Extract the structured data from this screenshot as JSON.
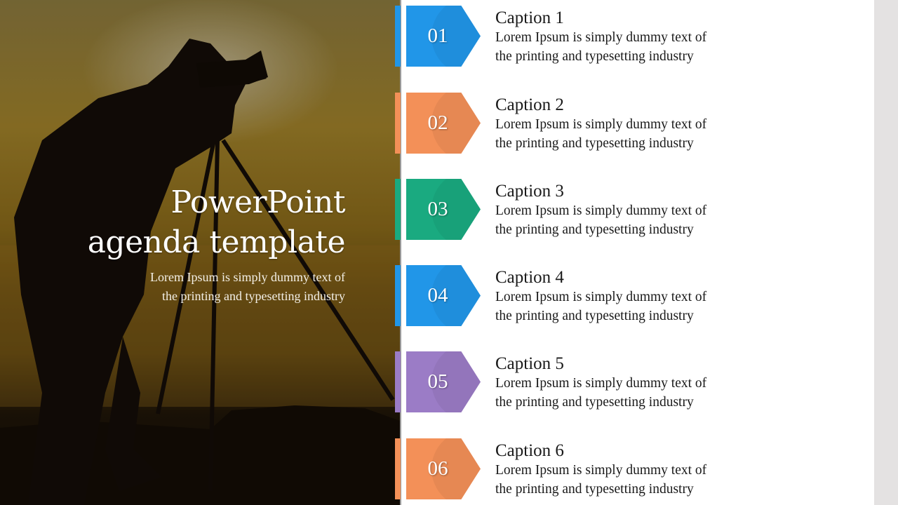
{
  "slide": {
    "title_lines": [
      "PowerPoint",
      "agenda template"
    ],
    "description_lines": [
      "Lorem Ipsum is simply dummy text of",
      "the printing and typesetting industry"
    ],
    "image": "photographer-silhouette-sunset"
  },
  "agenda": [
    {
      "number": "01",
      "caption": "Caption 1",
      "lines": [
        "Lorem Ipsum is simply dummy text of",
        "the printing and typesetting industry"
      ],
      "color": "#2196e8"
    },
    {
      "number": "02",
      "caption": "Caption 2",
      "lines": [
        "Lorem Ipsum is simply dummy text of",
        "the printing and typesetting industry"
      ],
      "color": "#f39058"
    },
    {
      "number": "03",
      "caption": "Caption 3",
      "lines": [
        "Lorem Ipsum is simply dummy text of",
        "the printing and typesetting industry"
      ],
      "color": "#1aaa80"
    },
    {
      "number": "04",
      "caption": "Caption 4",
      "lines": [
        "Lorem Ipsum is simply dummy text of",
        "the printing and typesetting industry"
      ],
      "color": "#2196e8"
    },
    {
      "number": "05",
      "caption": "Caption 5",
      "lines": [
        "Lorem Ipsum is simply dummy text of",
        "the printing and typesetting industry"
      ],
      "color": "#9b7cc6"
    },
    {
      "number": "06",
      "caption": "Caption 6",
      "lines": [
        "Lorem Ipsum is simply dummy text of",
        "the printing and typesetting industry"
      ],
      "color": "#f39058"
    }
  ]
}
